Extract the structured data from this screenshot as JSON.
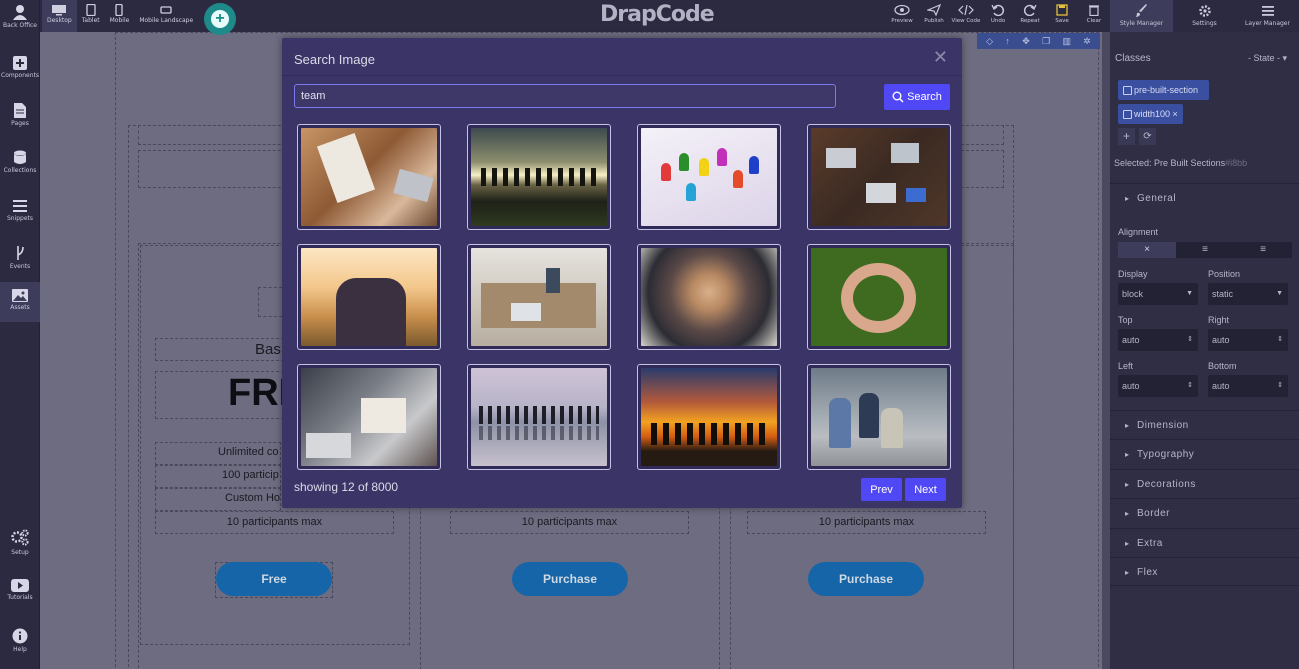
{
  "app": {
    "brand": "DrapCode"
  },
  "left_nav": [
    {
      "label": "Back Office",
      "icon": "user-icon"
    },
    {
      "label": "Components",
      "icon": "plus-box-icon"
    },
    {
      "label": "Pages",
      "icon": "file-icon"
    },
    {
      "label": "Collections",
      "icon": "database-icon"
    },
    {
      "label": "Snippets",
      "icon": "bars-icon"
    },
    {
      "label": "Events",
      "icon": "branch-icon"
    },
    {
      "label": "Assets",
      "icon": "image-icon"
    },
    {
      "label": "Setup",
      "icon": "cogs-icon"
    },
    {
      "label": "Tutorials",
      "icon": "youtube-icon"
    },
    {
      "label": "Help",
      "icon": "info-icon"
    }
  ],
  "devices": [
    {
      "label": "Desktop",
      "icon": "desktop-icon"
    },
    {
      "label": "Tablet",
      "icon": "tablet-icon"
    },
    {
      "label": "Mobile",
      "icon": "mobile-icon"
    },
    {
      "label": "Mobile Landscape",
      "icon": "mobile-landscape-icon"
    }
  ],
  "actions": [
    {
      "label": "Preview",
      "icon": "eye-icon"
    },
    {
      "label": "Publish",
      "icon": "send-icon"
    },
    {
      "label": "View Code",
      "icon": "code-icon"
    },
    {
      "label": "Undo",
      "icon": "undo-icon"
    },
    {
      "label": "Repeat",
      "icon": "redo-icon"
    },
    {
      "label": "Save",
      "icon": "save-icon"
    },
    {
      "label": "Clear",
      "icon": "trash-icon"
    }
  ],
  "right_tabs": [
    {
      "label": "Style Manager",
      "icon": "brush-icon"
    },
    {
      "label": "Settings",
      "icon": "gear-icon"
    },
    {
      "label": "Layer Manager",
      "icon": "layers-icon"
    }
  ],
  "canvas": {
    "plan_label": "Bas",
    "plan_price": "FRI",
    "features": [
      "Unlimited co",
      "100 particip",
      "Custom Ho",
      "10 participants max"
    ],
    "col2_feature": "10 participants max",
    "col3_feature": "10 participants max",
    "buttons": [
      "Free",
      "Purchase",
      "Purchase"
    ]
  },
  "style_manager": {
    "classes_label": "Classes",
    "state_label": "- State -",
    "chips": [
      "pre-built-section",
      "width100"
    ],
    "selected_label": "Selected:",
    "selected_value": "Pre Built Sections",
    "selected_id": "#i8bb",
    "general_label": "General",
    "alignment_label": "Alignment",
    "fields": [
      {
        "label": "Display",
        "value": "block"
      },
      {
        "label": "Position",
        "value": "static"
      },
      {
        "label": "Top",
        "value": "auto"
      },
      {
        "label": "Right",
        "value": "auto"
      },
      {
        "label": "Left",
        "value": "auto"
      },
      {
        "label": "Bottom",
        "value": "auto"
      }
    ],
    "sectors": [
      "Dimension",
      "Typography",
      "Decorations",
      "Border",
      "Extra",
      "Flex"
    ]
  },
  "modal": {
    "title": "Search Image",
    "query": "team",
    "search_label": "Search",
    "status": "showing 12 of 8000",
    "prev_label": "Prev",
    "next_label": "Next",
    "images": [
      "hands-stacked-photo",
      "silhouettes-sunset-photo",
      "colored-pawns-photo",
      "laptops-desk-photo",
      "friends-hugging-photo",
      "office-meeting-photo",
      "hands-huddle-photo",
      "hands-circle-photo",
      "office-paperwork-photo",
      "beach-silhouettes-photo",
      "sunset-jumping-photo",
      "students-stairs-photo"
    ]
  }
}
